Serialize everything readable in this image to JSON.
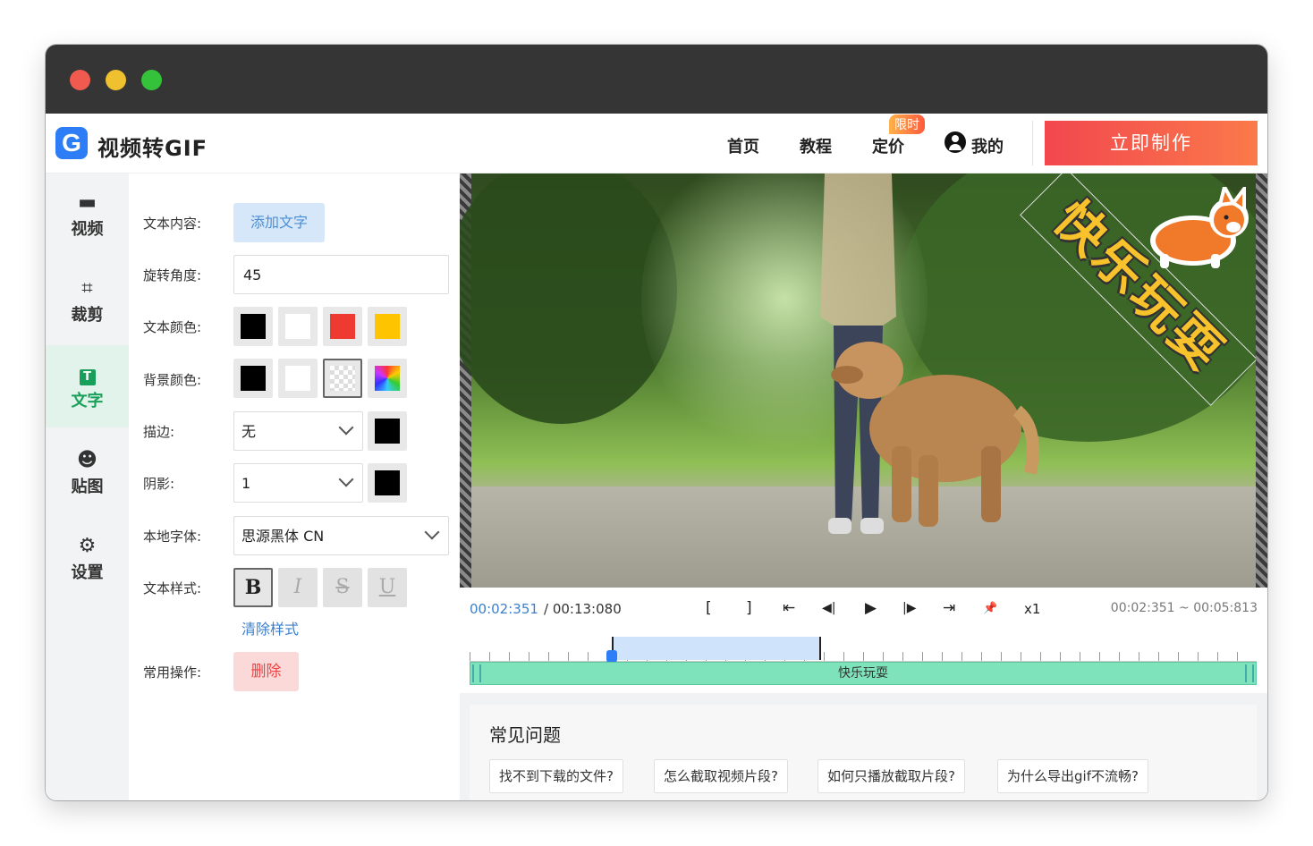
{
  "header": {
    "logo_letter": "G",
    "brand": "视频转GIF",
    "nav": [
      "首页",
      "教程",
      "定价",
      "我的"
    ],
    "badge": "限时",
    "cta": "立即制作"
  },
  "sidebar": {
    "items": [
      {
        "label": "视频",
        "icon": "video-icon"
      },
      {
        "label": "裁剪",
        "icon": "crop-icon"
      },
      {
        "label": "文字",
        "icon": "text-icon"
      },
      {
        "label": "贴图",
        "icon": "sticker-icon"
      },
      {
        "label": "设置",
        "icon": "gear-icon"
      }
    ]
  },
  "panel": {
    "labels": {
      "content": "文本内容:",
      "rotate": "旋转角度:",
      "text_color": "文本颜色:",
      "bg_color": "背景颜色:",
      "stroke": "描边:",
      "shadow": "阴影:",
      "font": "本地字体:",
      "style": "文本样式:",
      "ops": "常用操作:"
    },
    "add_text": "添加文字",
    "rotate_value": "45",
    "text_colors": [
      "#000000",
      "#ffffff",
      "#ee3a30",
      "#ffc400"
    ],
    "bg_colors": [
      "#000000",
      "#ffffff",
      "transparent",
      "rainbow"
    ],
    "stroke_value": "无",
    "shadow_value": "1",
    "font_value": "思源黑体 CN",
    "style_buttons": [
      "B",
      "I",
      "S",
      "U"
    ],
    "clear_style": "清除样式",
    "delete": "删除"
  },
  "video": {
    "overlay_text": "快乐玩耍"
  },
  "controls": {
    "current_time": "00:02:351",
    "total_time": "/ 00:13:080",
    "buttons": [
      "[",
      "]",
      "⇤",
      "◀|",
      "▶",
      "|▶",
      "⇥",
      "📌",
      "x1"
    ],
    "range": "00:02:351 ~ 00:05:813"
  },
  "timeline": {
    "track_label": "快乐玩耍"
  },
  "faq": {
    "title": "常见问题",
    "items": [
      "找不到下载的文件?",
      "怎么截取视频片段?",
      "如何只播放截取片段?",
      "为什么导出gif不流畅?"
    ]
  }
}
